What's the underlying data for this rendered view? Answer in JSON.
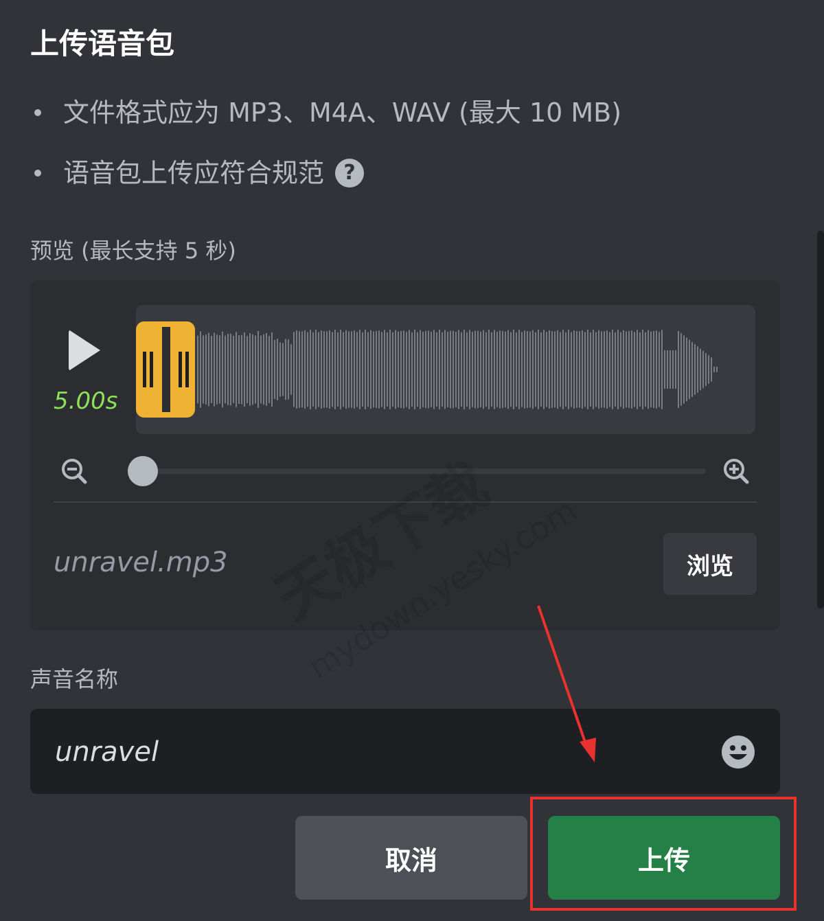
{
  "dialog": {
    "title": "上传语音包",
    "bullets": [
      "文件格式应为 MP3、M4A、WAV (最大 10 MB)",
      "语音包上传应符合规范"
    ],
    "help_icon": "?"
  },
  "preview": {
    "label": "预览 (最长支持 5 秒)",
    "duration": "5.00s",
    "file_name": "unravel.mp3",
    "browse_label": "浏览",
    "zoom_level": 0
  },
  "sound_name": {
    "label": "声音名称",
    "value": "unravel"
  },
  "actions": {
    "cancel_label": "取消",
    "upload_label": "上传"
  },
  "watermark": {
    "main": "天极下载",
    "sub": "mydown.yesky.com"
  },
  "colors": {
    "background": "#313338",
    "accent_green": "#248046",
    "duration_green": "#8ee05b",
    "handle_yellow": "#f0b232",
    "annotation_red": "#e8322f"
  },
  "icons": [
    "help-icon",
    "play-icon",
    "zoom-out-icon",
    "zoom-in-icon",
    "emoji-icon"
  ]
}
